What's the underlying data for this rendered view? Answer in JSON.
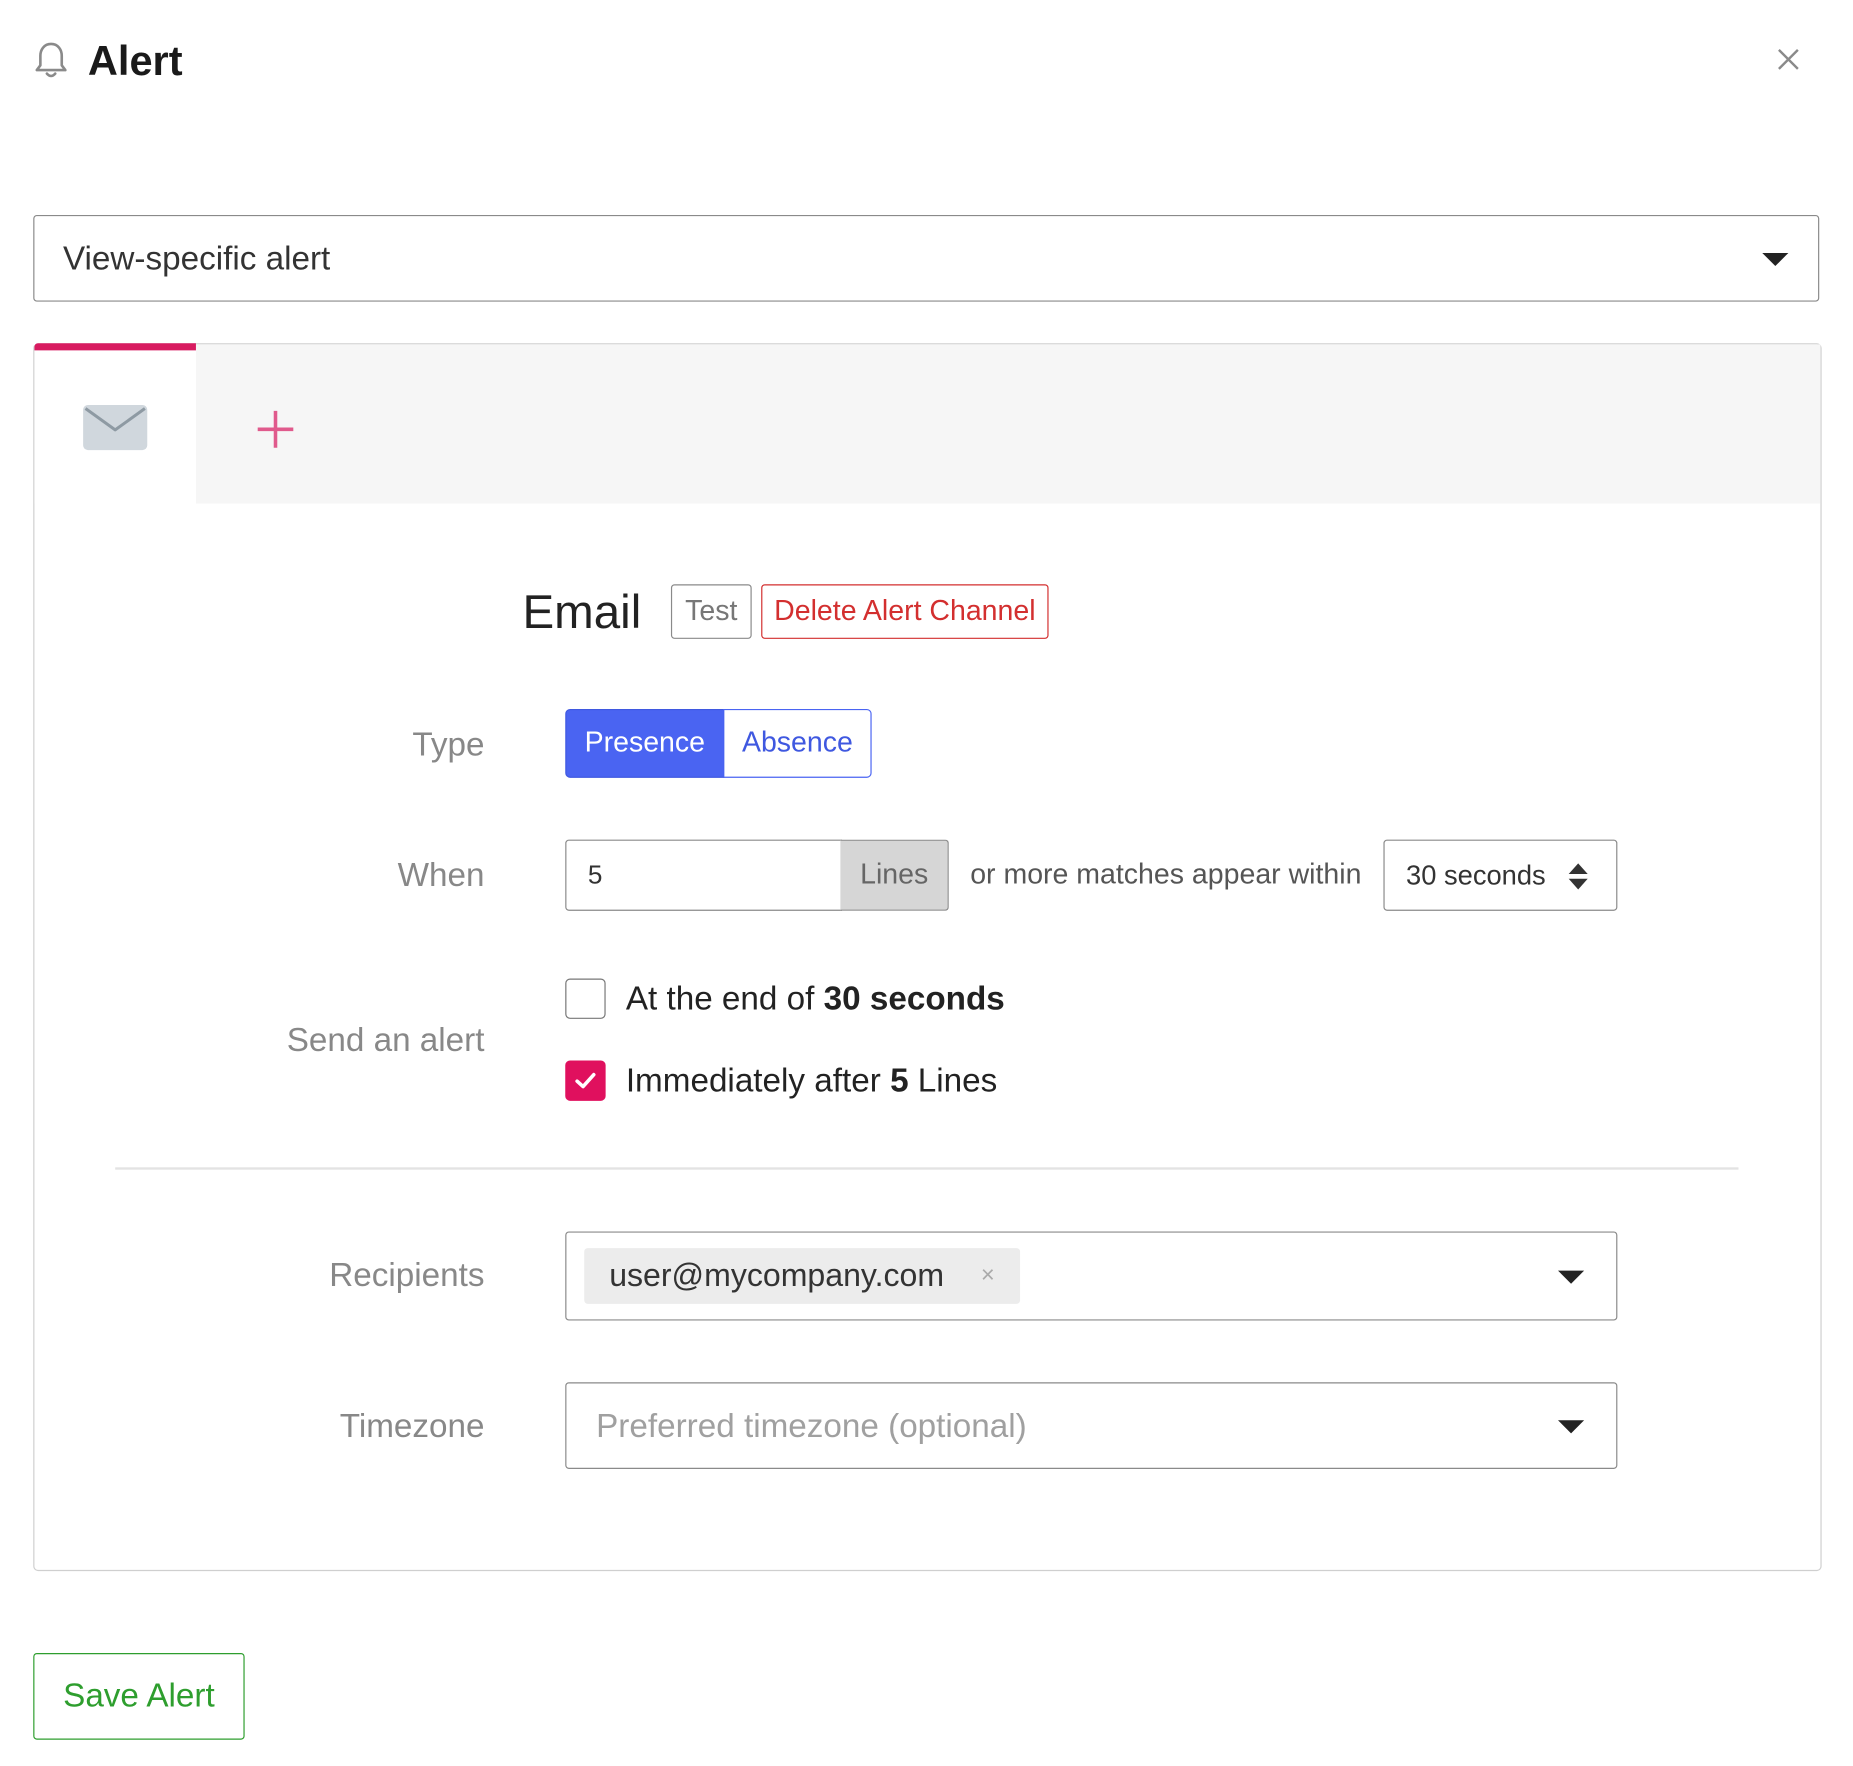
{
  "header": {
    "title": "Alert",
    "icon": "bell-icon",
    "close_icon": "close-icon"
  },
  "alert_scope": {
    "selected": "View-specific alert"
  },
  "channel_tabs": {
    "active_icon": "envelope-icon",
    "add_icon": "plus-icon",
    "accent_color": "#d81b60"
  },
  "channel": {
    "title": "Email",
    "test_label": "Test",
    "delete_label": "Delete Alert Channel"
  },
  "type_row": {
    "label": "Type",
    "options": [
      "Presence",
      "Absence"
    ],
    "selected": "Presence",
    "selected_color": "#4a64f2"
  },
  "when_row": {
    "label": "When",
    "count_value": "5",
    "unit": "Lines",
    "middle_text": "or more matches appear within",
    "period": "30 seconds"
  },
  "send_row": {
    "label": "Send an alert",
    "option_end": {
      "prefix": "At the end of",
      "bold": "30 seconds",
      "checked": false
    },
    "option_immediate": {
      "prefix": "Immediately after",
      "bold": "5",
      "suffix": "Lines",
      "checked": true
    },
    "checked_color": "#e0105e"
  },
  "recipients_row": {
    "label": "Recipients",
    "chips": [
      "user@mycompany.com"
    ],
    "chip_remove": "×"
  },
  "timezone_row": {
    "label": "Timezone",
    "placeholder": "Preferred timezone (optional)"
  },
  "footer": {
    "save_label": "Save Alert",
    "save_color": "#2e9e2e"
  }
}
